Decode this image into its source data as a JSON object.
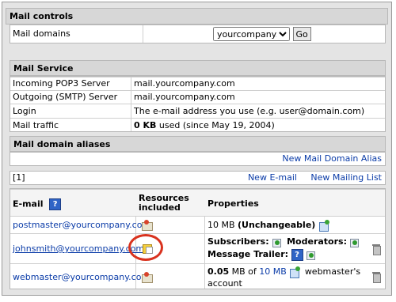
{
  "mail_controls": {
    "title": "Mail controls",
    "domains_label": "Mail domains",
    "domain_selected": "yourcompany.com",
    "go_label": "Go"
  },
  "mail_service": {
    "title": "Mail Service",
    "rows": [
      {
        "label": "Incoming POP3 Server",
        "value": "mail.yourcompany.com"
      },
      {
        "label": "Outgoing (SMTP) Server",
        "value": "mail.yourcompany.com"
      },
      {
        "label": "Login",
        "value": "The e-mail address you use (e.g. user@domain.com)"
      }
    ],
    "traffic_label": "Mail traffic",
    "traffic_value": "0 KB",
    "traffic_suffix": "used (since May 19, 2004)"
  },
  "aliases": {
    "title": "Mail domain aliases",
    "new_alias_link": "New Mail Domain Alias"
  },
  "list_toolbar": {
    "count": "[1]",
    "new_email": "New E-mail",
    "new_list": "New Mailing List"
  },
  "table": {
    "headers": {
      "email": "E-mail",
      "resources": "Resources included",
      "properties": "Properties"
    },
    "rows": [
      {
        "email": "postmaster@yourcompany.com",
        "size": "10 MB",
        "note": "(Unchangeable)"
      },
      {
        "email": "johnsmith@yourcompany.com",
        "subscribers": "Subscribers:",
        "moderators": "Moderators:",
        "trailer": "Message Trailer:"
      },
      {
        "email": "webmaster@yourcompany.com",
        "used": "0.05",
        "mb_of": "MB of",
        "quota": "10 MB",
        "account": "webmaster's account"
      }
    ]
  },
  "colors": {
    "link": "#0b3ca8",
    "header_bg": "#d7d7d7",
    "annotation_circle": "#d9321e"
  }
}
